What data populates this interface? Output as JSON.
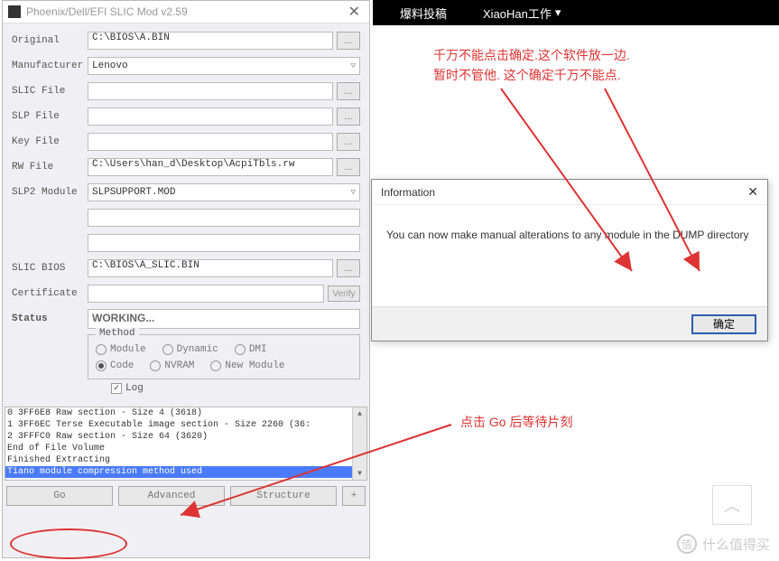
{
  "topbar": {
    "item1": "爆料投稿",
    "item2": "XiaoHan工作"
  },
  "window": {
    "title": "Phoenix/Dell/EFI SLIC Mod v2.59",
    "labels": {
      "original": "Original",
      "manufacturer": "Manufacturer",
      "slic_file": "SLIC File",
      "slp_file": "SLP File",
      "key_file": "Key File",
      "rw_file": "RW File",
      "slp2_module": "SLP2 Module",
      "slic_bios": "SLIC BIOS",
      "certificate": "Certificate",
      "status": "Status"
    },
    "values": {
      "original": "C:\\BIOS\\A.BIN",
      "manufacturer": "Lenovo",
      "rw_file": "C:\\Users\\han_d\\Desktop\\AcpiTbls.rw",
      "slp2_module": "SLPSUPPORT.MOD",
      "slic_bios": "C:\\BIOS\\A_SLIC.BIN",
      "status": "WORKING...",
      "verify": "Verify"
    },
    "method": {
      "title": "Method",
      "opts": {
        "module": "Module",
        "dynamic": "Dynamic",
        "dmi": "DMI",
        "code": "Code",
        "nvram": "NVRAM",
        "new_module": "New Module"
      }
    },
    "log_label": "Log",
    "log_lines": [
      "   0 3FF6E8 Raw section - Size 4  (3618)",
      "   1 3FF6EC Terse Executable image section - Size 2260  (36:",
      "   2 3FFFC0 Raw section - Size 64  (3620)",
      "End of File Volume",
      "",
      "Finished Extracting",
      "Tiano module compression method used"
    ],
    "buttons": {
      "go": "Go",
      "advanced": "Advanced",
      "structure": "Structure",
      "more": "+"
    }
  },
  "dialog": {
    "title": "Information",
    "body": "You can now make manual alterations to any module in the DUMP directory",
    "ok": "确定"
  },
  "annotations": {
    "top1": "千万不能点击确定.这个软件放一边.",
    "top2": "暂时不管他. 这个确定千万不能点.",
    "bottom": "点击 Go 后等待片刻"
  },
  "watermark": "什么值得买"
}
